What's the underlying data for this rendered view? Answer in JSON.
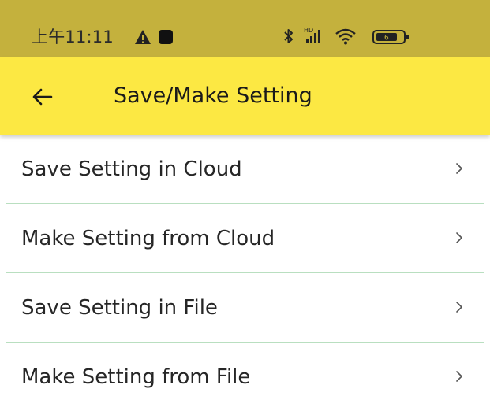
{
  "status_bar": {
    "time": "上午11:11",
    "icons": [
      "warning-icon",
      "square-icon",
      "bluetooth-icon",
      "hd-signal-icon",
      "wifi-icon",
      "battery-icon"
    ],
    "hd_label": "HD",
    "battery_level": "6"
  },
  "app_bar": {
    "back_icon": "arrow-left-icon",
    "title": "Save/Make Setting"
  },
  "menu": {
    "items": [
      {
        "label": "Save Setting in Cloud"
      },
      {
        "label": "Make Setting from Cloud"
      },
      {
        "label": "Save Setting in File"
      },
      {
        "label": "Make Setting from File"
      }
    ],
    "chevron": "›"
  },
  "colors": {
    "status_bar_bg": "#c4b13d",
    "app_bar_bg": "#fce843",
    "divider": "#b9dfc0",
    "text": "#262626"
  }
}
